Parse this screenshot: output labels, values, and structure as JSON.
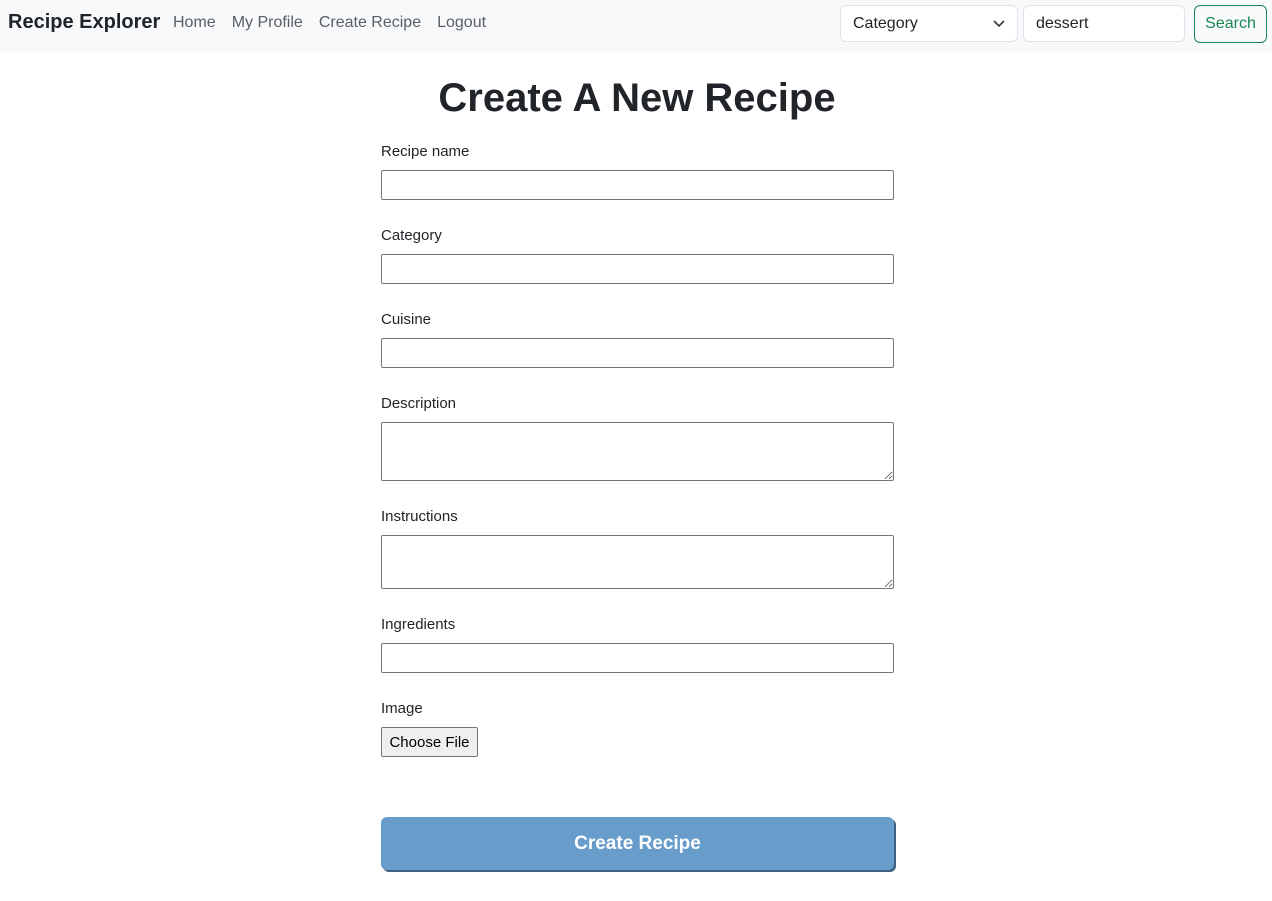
{
  "navbar": {
    "brand": "Recipe Explorer",
    "links": [
      "Home",
      "My Profile",
      "Create Recipe",
      "Logout"
    ],
    "category_select": {
      "selected": "Category"
    },
    "search": {
      "value": "dessert"
    },
    "search_button": "Search"
  },
  "page": {
    "title": "Create A New Recipe"
  },
  "form": {
    "fields": [
      {
        "label": "Recipe name",
        "value": ""
      },
      {
        "label": "Category",
        "value": ""
      },
      {
        "label": "Cuisine",
        "value": ""
      },
      {
        "label": "Description",
        "value": ""
      },
      {
        "label": "Instructions",
        "value": ""
      },
      {
        "label": "Ingredients",
        "value": ""
      }
    ],
    "image_label": "Image",
    "file_button": "Choose File",
    "submit_label": "Create Recipe"
  },
  "colors": {
    "navbar_bg": "#f8f9fa",
    "search_button": "#198754",
    "submit_bg": "#679ccb"
  }
}
